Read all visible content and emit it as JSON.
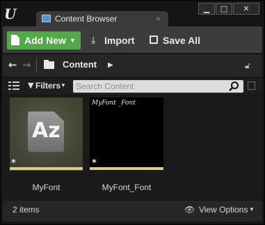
{
  "titlebar": {
    "tab_label": "Content Browser",
    "tab_close_glyph": "×",
    "controls": {
      "minimize": "▁",
      "maximize": "□",
      "close": "✕"
    }
  },
  "toolbar": {
    "add_new_label": "Add New",
    "import_label": "Import",
    "save_all_label": "Save All",
    "accent_color": "#52a947"
  },
  "path": {
    "folder": "Content"
  },
  "filters": {
    "label": "Filters",
    "search_placeholder": "Search Content"
  },
  "assets": [
    {
      "name": "MyFont",
      "icon": "font-asset-icon",
      "glyph": "Az"
    },
    {
      "name": "MyFont_Font",
      "icon": "font-texture-preview",
      "preview_text": "MyFont _Font"
    }
  ],
  "status": {
    "item_count": "2 items",
    "view_options_label": "View Options"
  }
}
